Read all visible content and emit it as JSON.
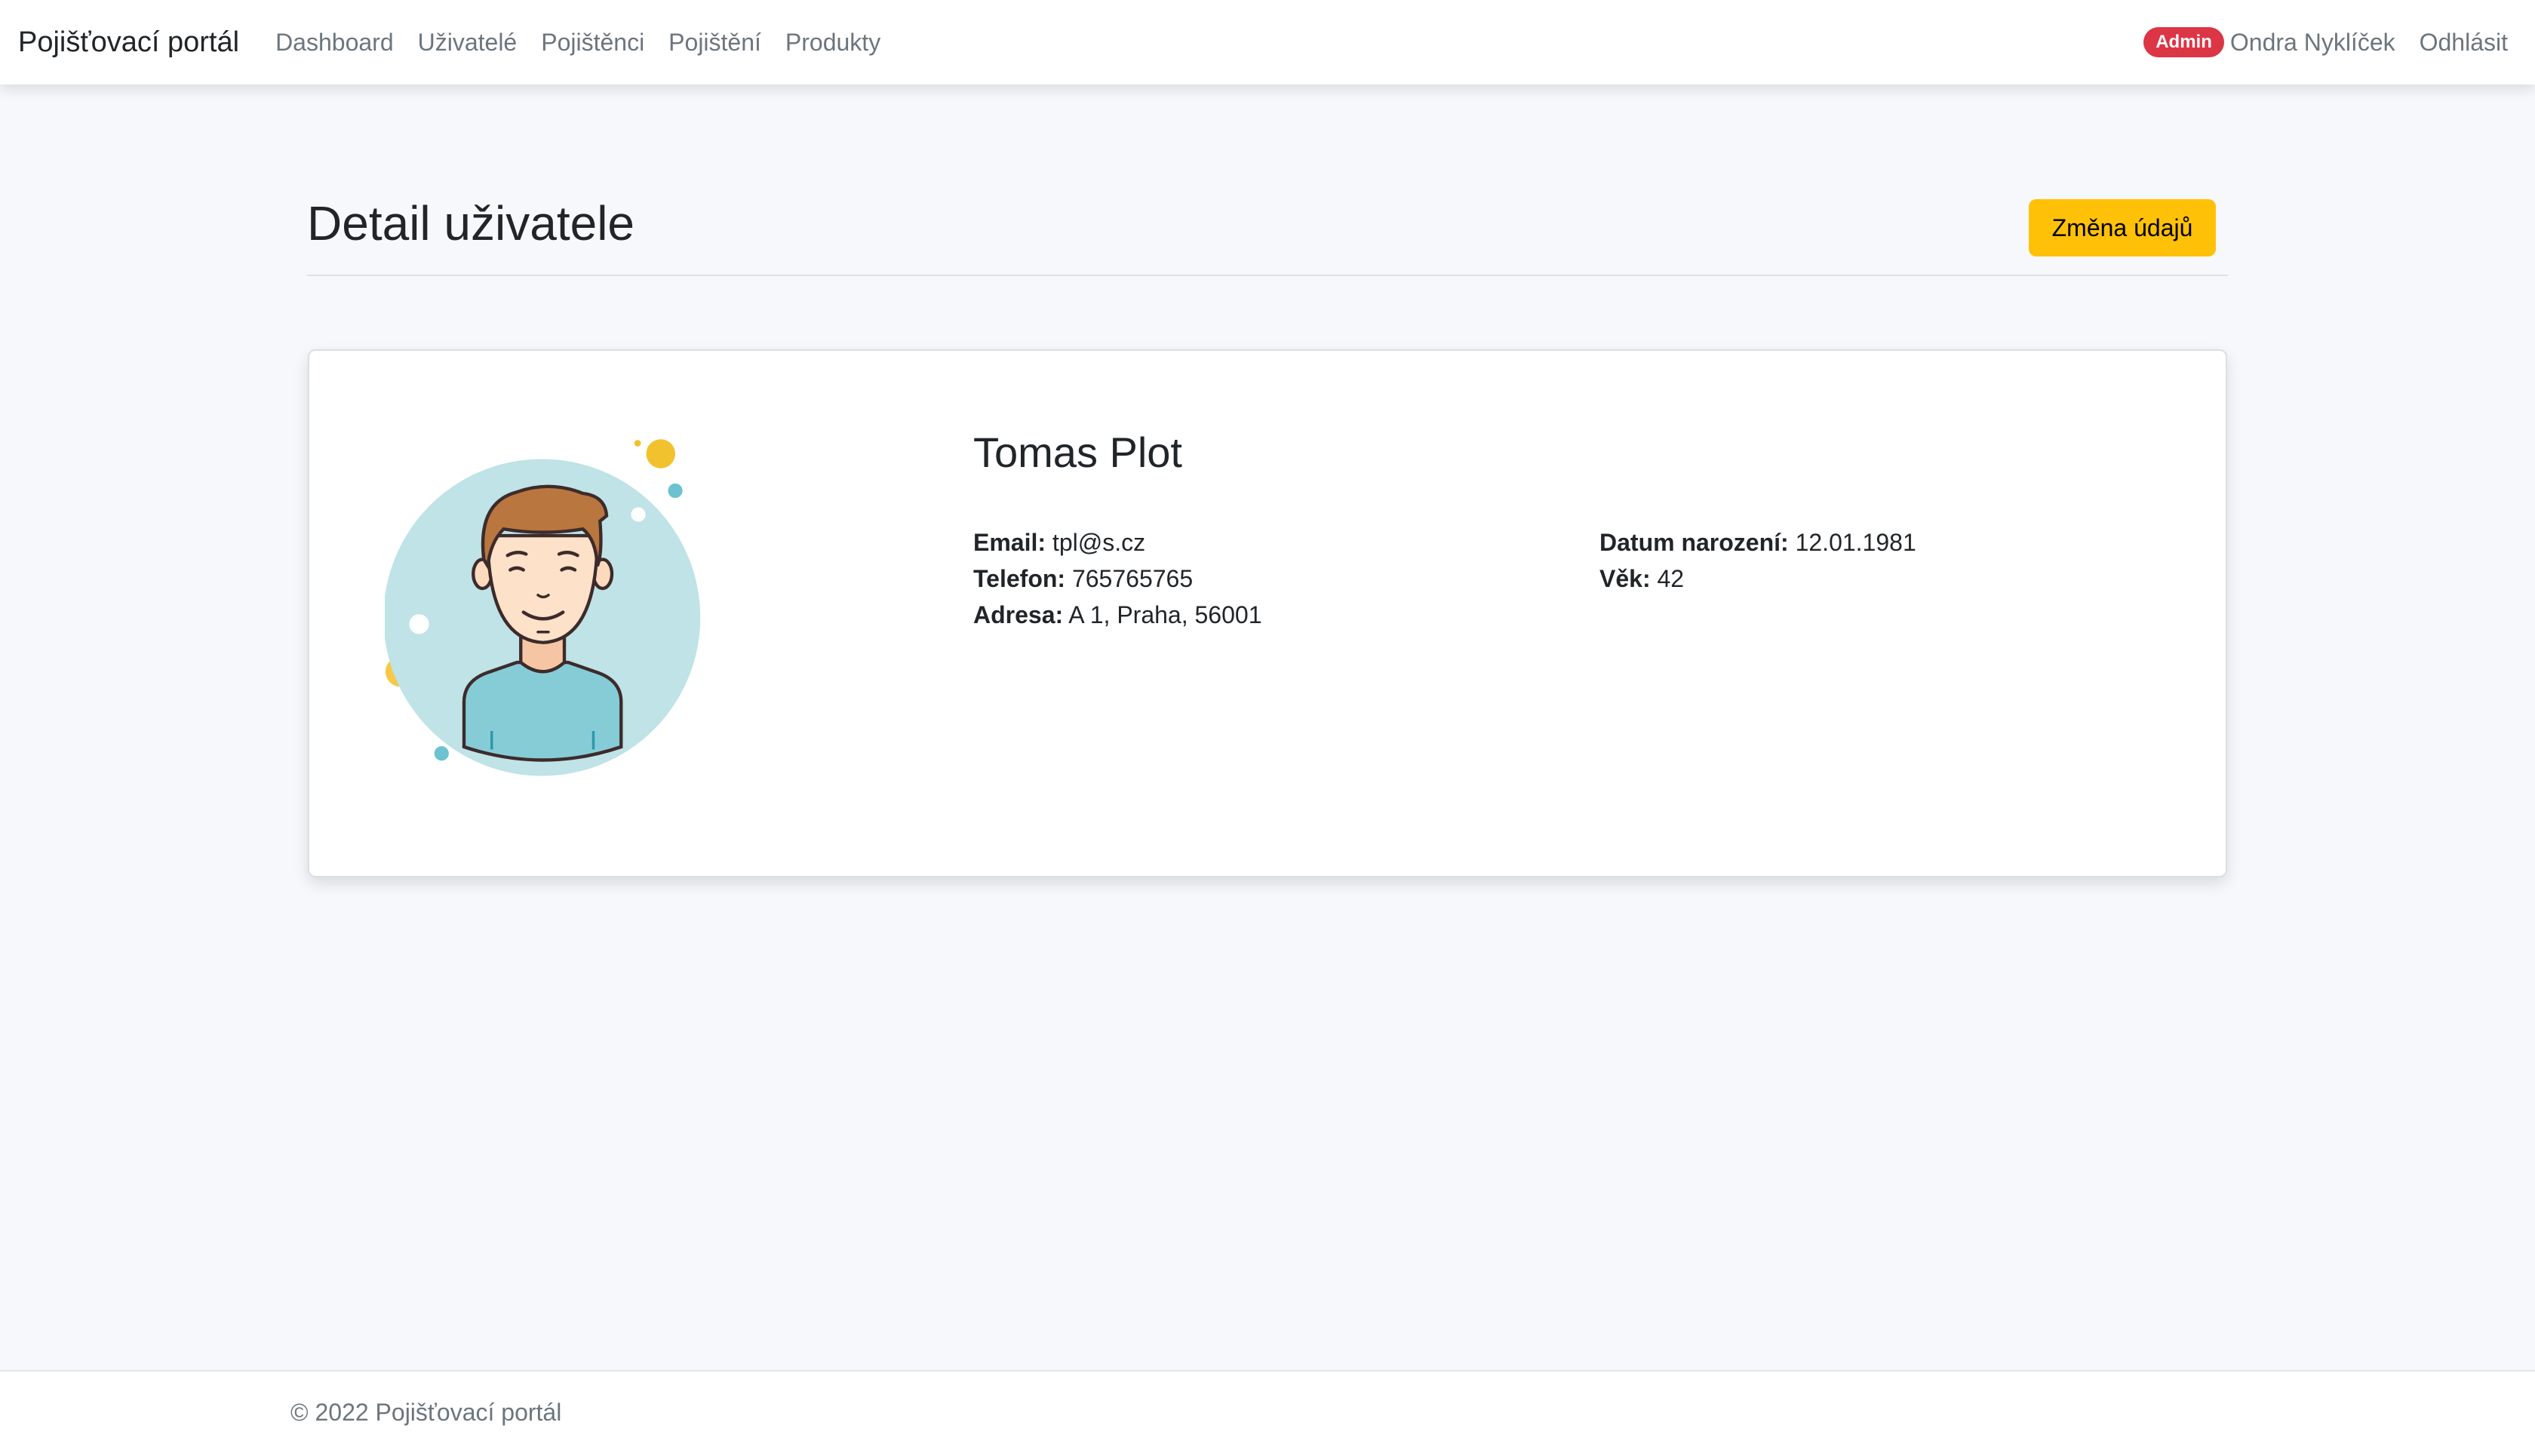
{
  "navbar": {
    "brand": "Pojišťovací portál",
    "links": [
      "Dashboard",
      "Uživatelé",
      "Pojištěnci",
      "Pojištění",
      "Produkty"
    ],
    "role_badge": "Admin",
    "user_name": "Ondra Nyklíček",
    "logout": "Odhlásit"
  },
  "page": {
    "title": "Detail uživatele",
    "edit_button": "Změna údajů"
  },
  "profile": {
    "name": "Tomas Plot",
    "email_label": "Email:",
    "email": "tpl@s.cz",
    "phone_label": "Telefon:",
    "phone": "765765765",
    "address_label": "Adresa:",
    "address": "A 1, Praha, 56001",
    "birth_label": "Datum narození:",
    "birth": "12.01.1981",
    "age_label": "Věk:",
    "age": "42"
  },
  "footer": {
    "text": "© 2022 Pojišťovací portál"
  },
  "colors": {
    "accent_warning": "#ffc107",
    "badge_danger": "#dc3545"
  }
}
